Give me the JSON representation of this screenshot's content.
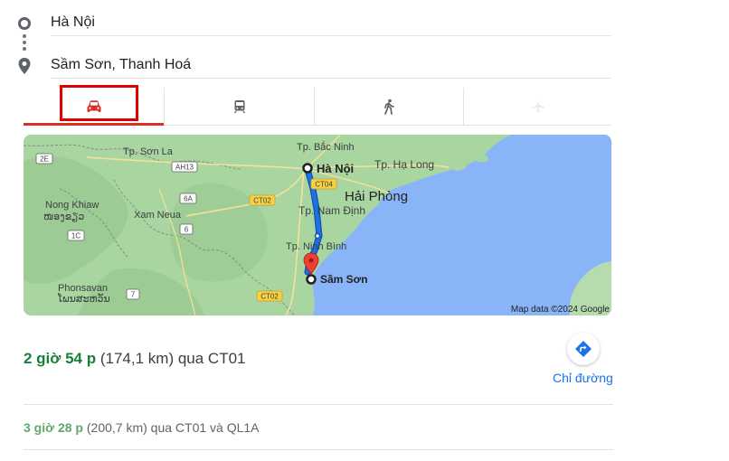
{
  "route": {
    "origin": "Hà Nội",
    "destination": "Sầm Sơn, Thanh Hoá"
  },
  "travel_modes": [
    {
      "name": "driving",
      "icon": "car-icon",
      "selected": true
    },
    {
      "name": "transit",
      "icon": "train-icon",
      "selected": false
    },
    {
      "name": "walking",
      "icon": "walking-icon",
      "selected": false
    },
    {
      "name": "flight",
      "icon": "plane-icon",
      "selected": false
    }
  ],
  "map": {
    "attribution": "Map data ©2024 Google",
    "labels": {
      "son_la": "Tp. Sơn La",
      "bac_ninh": "Tp. Bắc Ninh",
      "ha_noi": "Hà Nội",
      "ha_long": "Tp. Hạ Long",
      "hai_phong": "Hải Phòng",
      "nong_khiaw": "Nong Khiaw",
      "nong_khiaw_lao": "ໜອງຂຽວ",
      "xam_neua": "Xam Neua",
      "nam_dinh": "Tp. Nam Định",
      "ninh_binh": "Tp. Ninh Bình",
      "sam_son": "Sầm Sơn",
      "phonsavan": "Phonsavan",
      "phonsavan_lao": "ໂພນສະຫວັນ"
    },
    "road_shields": {
      "e2": "2E",
      "ah13": "AH13",
      "ct04": "CT04",
      "ct02_top": "CT02",
      "r6a": "6A",
      "r6": "6",
      "r1c": "1C",
      "r7": "7",
      "ct02_bottom": "CT02"
    },
    "colors": {
      "land": "#a8d5a0",
      "water": "#8ab4f8",
      "route": "#1a73e8",
      "marker": "#ea4335"
    }
  },
  "primary_route": {
    "duration": "2 giờ 54 p",
    "details": "(174,1 km) qua CT01"
  },
  "directions_button": {
    "label": "Chỉ đường",
    "icon": "directions-icon"
  },
  "alternate_route": {
    "duration": "3 giờ 28 p",
    "details": "(200,7 km) qua CT01 và QL1A"
  }
}
